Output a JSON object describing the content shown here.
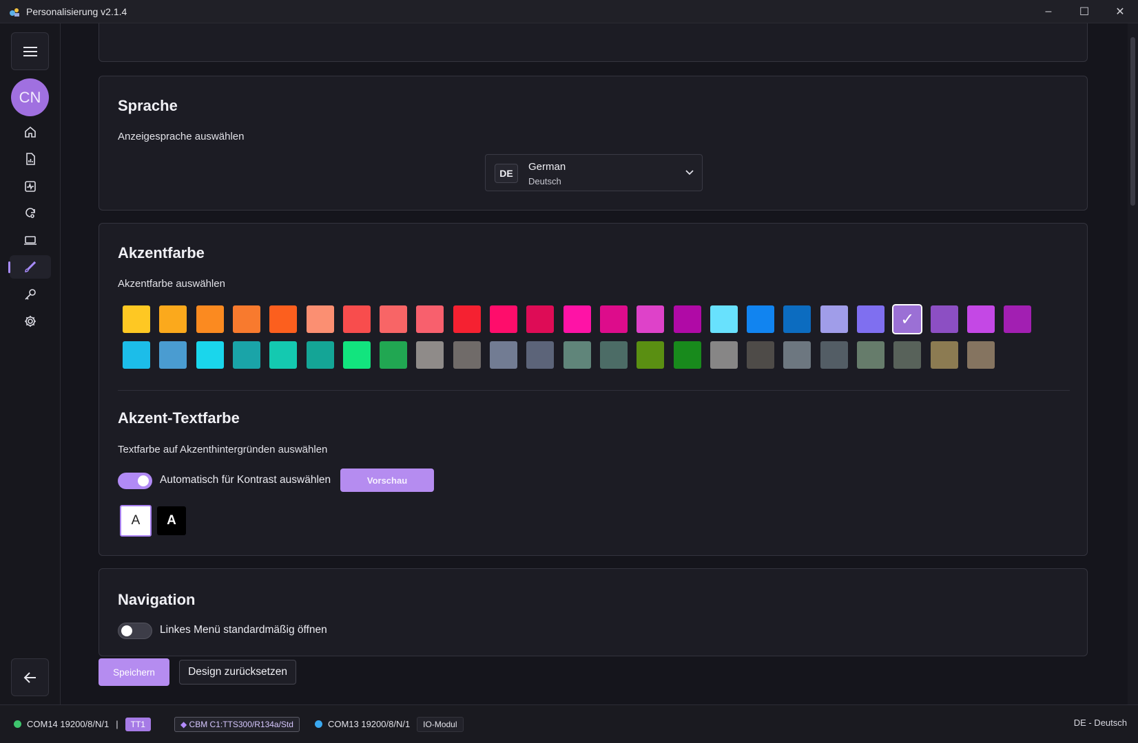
{
  "window": {
    "title": "Personalisierung v2.1.4",
    "minimize": "–",
    "maximize": "☐",
    "close": "✕"
  },
  "sidebar": {
    "avatar_initials": "CN",
    "items": [
      {
        "icon": "home-icon"
      },
      {
        "icon": "report-icon"
      },
      {
        "icon": "activity-icon"
      },
      {
        "icon": "refresh-search-icon"
      },
      {
        "icon": "laptop-icon"
      },
      {
        "icon": "brush-icon",
        "active": true
      },
      {
        "icon": "key-icon"
      },
      {
        "icon": "gear-icon"
      }
    ]
  },
  "language": {
    "title": "Sprache",
    "subtitle": "Anzeigesprache auswählen",
    "badge": "DE",
    "name": "German",
    "native": "Deutsch"
  },
  "accent": {
    "title": "Akzentfarbe",
    "subtitle": "Akzentfarbe auswählen",
    "selected_index": 21,
    "check": "✓",
    "row1": [
      "#fec823",
      "#fba91c",
      "#fb8a20",
      "#f87a2e",
      "#fc5f1e",
      "#fb8f72",
      "#f84d4d",
      "#f86566",
      "#f8606d",
      "#f52131",
      "#fe0d6b",
      "#de0c56",
      "#fe13a6",
      "#dd0c8b",
      "#de42c9",
      "#b00aa6",
      "#68e1fd",
      "#1184f0",
      "#0c6cc0",
      "#a09de9",
      "#7f6ff0",
      "#9b70d5",
      "#8c4fc3",
      "#c448e5",
      "#a21fb2"
    ],
    "row2": [
      "#1cbde9",
      "#4a9cd1",
      "#1ad6ec",
      "#1aa4a8",
      "#14c9b0",
      "#14a596",
      "#12e47e",
      "#21a752",
      "#8f8b89",
      "#706b69",
      "#727c93",
      "#5c6479",
      "#60857a",
      "#4c6c66",
      "#5a8f12",
      "#188a1c",
      "#878686",
      "#4e4b48",
      "#6d7780",
      "#535d65",
      "#667c6b",
      "#58625a",
      "#8c7b52",
      "#857460"
    ]
  },
  "accent_text": {
    "title": "Akzent-Textfarbe",
    "subtitle": "Textfarbe auf Akzenthintergründen auswählen",
    "auto_label": "Automatisch für Kontrast auswählen",
    "auto_on": true,
    "preview_label": "Vorschau",
    "white_label": "A",
    "black_label": "A"
  },
  "navigation": {
    "title": "Navigation",
    "toggle_label": "Linkes Menü standardmäßig öffnen",
    "toggle_on": false
  },
  "actions": {
    "save": "Speichern",
    "reset": "Design zurücksetzen"
  },
  "status": {
    "port1": "COM14 19200/8/N/1",
    "separator": "|",
    "tag1": "TT1",
    "device": "CBM C1:TTS300/R134a/Std",
    "port2": "COM13 19200/8/N/1",
    "module": "IO-Modul",
    "language": "DE - Deutsch",
    "colors": {
      "port1": "#3ec46d",
      "port2": "#3aa8f0",
      "tag_bg": "#a67be6"
    }
  }
}
